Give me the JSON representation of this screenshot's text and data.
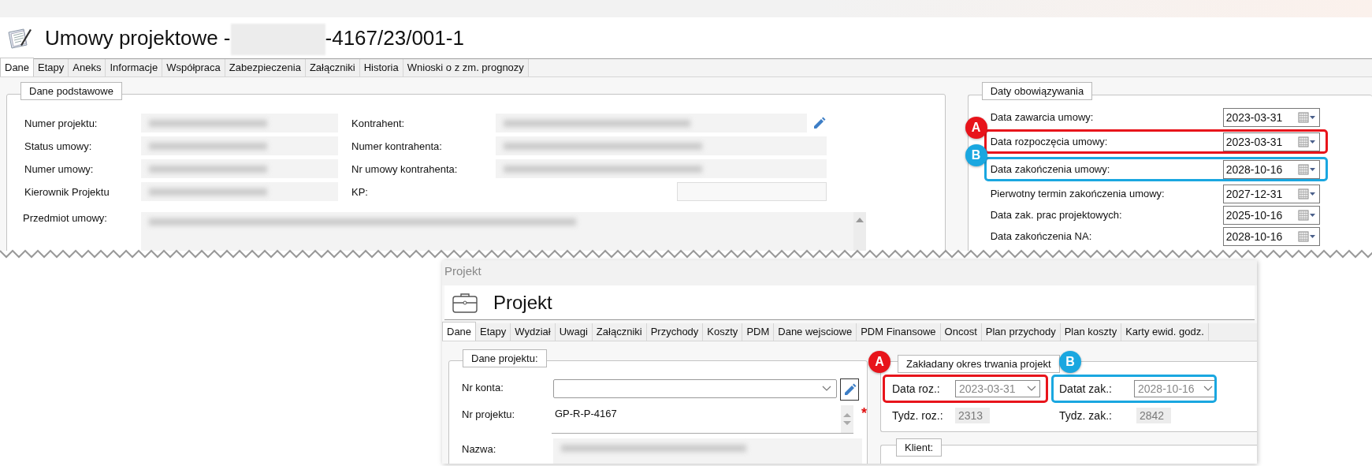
{
  "contract_window": {
    "title": "Umowy projektowe - ",
    "title_suffix": "-4167/23/001-1",
    "tabs": [
      {
        "label": "Dane",
        "selected": true
      },
      {
        "label": "Etapy",
        "selected": false
      },
      {
        "label": "Aneks",
        "selected": false
      },
      {
        "label": "Informacje",
        "selected": false
      },
      {
        "label": "Współpraca",
        "selected": false
      },
      {
        "label": "Zabezpieczenia",
        "selected": false
      },
      {
        "label": "Załączniki",
        "selected": false
      },
      {
        "label": "Historia",
        "selected": false
      },
      {
        "label": "Wnioski o z zm. prognozy",
        "selected": false
      }
    ],
    "basic_group": {
      "legend": "Dane podstawowe",
      "left_fields": [
        {
          "label": "Numer projektu:",
          "kind": "blurred"
        },
        {
          "label": "Status umowy:",
          "kind": "blurred"
        },
        {
          "label": "Numer umowy:",
          "kind": "blurred"
        },
        {
          "label": "Kierownik Projektu",
          "kind": "blurred"
        }
      ],
      "right_fields": [
        {
          "label": "Kontrahent:",
          "kind": "blurred",
          "edit_button": true
        },
        {
          "label": "Numer kontrahenta:",
          "kind": "blurred"
        },
        {
          "label": "Nr umowy kontrahenta:",
          "kind": "blurred"
        },
        {
          "label": "KP:",
          "kind": "empty"
        }
      ],
      "subject_label": "Przedmiot umowy:"
    },
    "dates_group": {
      "legend": "Daty obowiązywania",
      "rows": [
        {
          "label": "Data zawarcia umowy:",
          "value": "2023-03-31"
        },
        {
          "label": "Data rozpoczęcia umowy:",
          "value": "2023-03-31",
          "callout": {
            "letter": "A",
            "color": "#e8141b"
          }
        },
        {
          "label": "Data zakończenia umowy:",
          "value": "2028-10-16",
          "callout": {
            "letter": "B",
            "color": "#1aa7e0"
          }
        },
        {
          "label": "Pierwotny termin zakończenia umowy:",
          "value": "2027-12-31"
        },
        {
          "label": "Data zak. prac projektowych:",
          "value": "2025-10-16"
        },
        {
          "label": "Data zakończenia NA:",
          "value": "2028-10-16"
        }
      ]
    }
  },
  "project_window": {
    "caption": "Projekt",
    "title": "Projekt",
    "tabs": [
      {
        "label": "Dane",
        "selected": true
      },
      {
        "label": "Etapy",
        "selected": false
      },
      {
        "label": "Wydział",
        "selected": false
      },
      {
        "label": "Uwagi",
        "selected": false
      },
      {
        "label": "Załączniki",
        "selected": false
      },
      {
        "label": "Przychody",
        "selected": false
      },
      {
        "label": "Koszty",
        "selected": false
      },
      {
        "label": "PDM",
        "selected": false
      },
      {
        "label": "Dane wejsciowe",
        "selected": false
      },
      {
        "label": "PDM Finansowe",
        "selected": false
      },
      {
        "label": "Oncost",
        "selected": false
      },
      {
        "label": "Plan przychody",
        "selected": false
      },
      {
        "label": "Plan koszty",
        "selected": false
      },
      {
        "label": "Karty ewid. godz.",
        "selected": false
      }
    ],
    "project_group": {
      "legend": "Dane projektu:",
      "fields": [
        {
          "label": "Nr konta:",
          "kind": "combo"
        },
        {
          "label": "Nr projektu:",
          "kind": "memo",
          "value": "GP-R-P-4167",
          "required_mark": "*"
        },
        {
          "label": "Nazwa:",
          "kind": "blurred"
        }
      ]
    },
    "period_group": {
      "legend": "Zakładany okres trwania projekt",
      "dates": [
        {
          "label": "Data roz.:",
          "value": "2023-03-31",
          "callout": {
            "letter": "A",
            "color": "#e8141b"
          }
        },
        {
          "label": "Datat zak.:",
          "value": "2028-10-16",
          "callout": {
            "letter": "B",
            "color": "#1aa7e0"
          }
        }
      ],
      "weeks": [
        {
          "label": "Tydz. roz.:",
          "value": "2313",
          "disabled": true
        },
        {
          "label": "Tydz. zak.:",
          "value": "2842",
          "disabled": true
        }
      ]
    },
    "client_group": {
      "legend": "Klient:"
    }
  }
}
